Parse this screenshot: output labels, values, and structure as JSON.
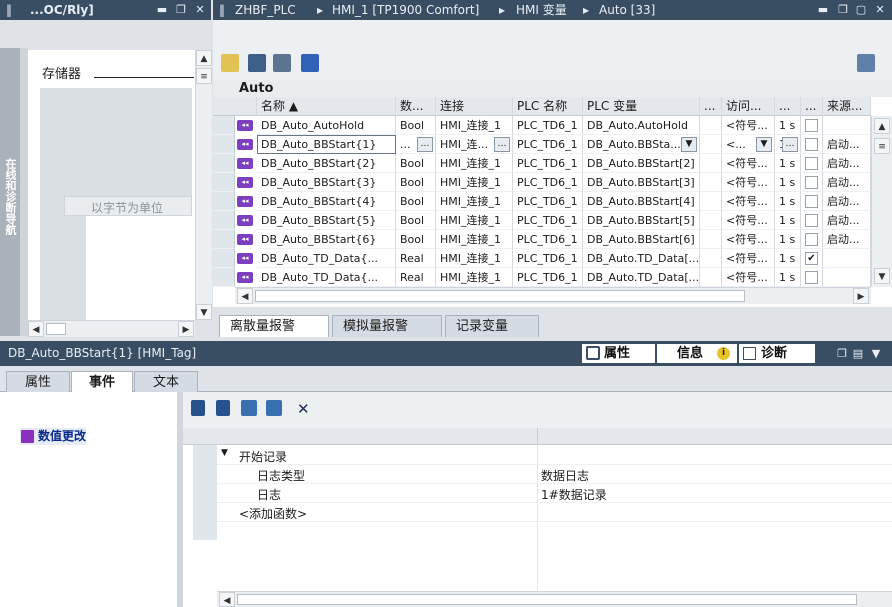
{
  "left_panel": {
    "title": "...OC/Rly]",
    "vertical_tab": "在线和诊断导航",
    "storage_label": "存储器",
    "unit_label": "以字节为单位"
  },
  "top_panel": {
    "breadcrumb": [
      "ZHBF_PLC",
      "HMI_1 [TP1900 Comfort]",
      "HMI 变量",
      "Auto [33]"
    ],
    "table_title": "Auto",
    "columns": [
      "名称 ▲",
      "数...",
      "连接",
      "PLC 名称",
      "PLC 变量",
      "...",
      "访问...",
      "...",
      "...",
      "来源..."
    ],
    "rows": [
      {
        "name": "DB_Auto_AutoHold",
        "type": "Bool",
        "conn": "HMI_连接_1",
        "plc": "PLC_TD6_1",
        "var": "DB_Auto.AutoHold",
        "access": "<符号...",
        "cycle": "1 s",
        "checked": false,
        "src": ""
      },
      {
        "name": "DB_Auto_BBStart{1}",
        "type": "...",
        "conn": "HMI_连...",
        "plc": "PLC_TD6_1",
        "var": "DB_Auto.BBSta...",
        "access": "<...",
        "cycle": "1 s",
        "checked": false,
        "src": "启动..."
      },
      {
        "name": "DB_Auto_BBStart{2}",
        "type": "Bool",
        "conn": "HMI_连接_1",
        "plc": "PLC_TD6_1",
        "var": "DB_Auto.BBStart[2]",
        "access": "<符号...",
        "cycle": "1 s",
        "checked": false,
        "src": "启动..."
      },
      {
        "name": "DB_Auto_BBStart{3}",
        "type": "Bool",
        "conn": "HMI_连接_1",
        "plc": "PLC_TD6_1",
        "var": "DB_Auto.BBStart[3]",
        "access": "<符号...",
        "cycle": "1 s",
        "checked": false,
        "src": "启动..."
      },
      {
        "name": "DB_Auto_BBStart{4}",
        "type": "Bool",
        "conn": "HMI_连接_1",
        "plc": "PLC_TD6_1",
        "var": "DB_Auto.BBStart[4]",
        "access": "<符号...",
        "cycle": "1 s",
        "checked": false,
        "src": "启动..."
      },
      {
        "name": "DB_Auto_BBStart{5}",
        "type": "Bool",
        "conn": "HMI_连接_1",
        "plc": "PLC_TD6_1",
        "var": "DB_Auto.BBStart[5]",
        "access": "<符号...",
        "cycle": "1 s",
        "checked": false,
        "src": "启动..."
      },
      {
        "name": "DB_Auto_BBStart{6}",
        "type": "Bool",
        "conn": "HMI_连接_1",
        "plc": "PLC_TD6_1",
        "var": "DB_Auto.BBStart[6]",
        "access": "<符号...",
        "cycle": "1 s",
        "checked": false,
        "src": "启动..."
      },
      {
        "name": "DB_Auto_TD_Data{...",
        "type": "Real",
        "conn": "HMI_连接_1",
        "plc": "PLC_TD6_1",
        "var": "DB_Auto.TD_Data[...",
        "access": "<符号...",
        "cycle": "1 s",
        "checked": true,
        "src": ""
      },
      {
        "name": "DB_Auto_TD_Data{...",
        "type": "Real",
        "conn": "HMI_连接_1",
        "plc": "PLC_TD6_1",
        "var": "DB_Auto.TD_Data[...",
        "access": "<符号...",
        "cycle": "1 s",
        "checked": false,
        "src": ""
      }
    ],
    "bottom_tabs": [
      "离散量报警",
      "模拟量报警",
      "记录变量"
    ]
  },
  "bottom_panel": {
    "title": "DB_Auto_BBStart{1} [HMI_Tag]",
    "right_tabs": [
      "属性",
      "信息",
      "诊断"
    ],
    "tabs": [
      "属性",
      "事件",
      "文本"
    ],
    "event_item": "数值更改",
    "tree": {
      "group": "开始记录",
      "rows": [
        {
          "label": "日志类型",
          "value": "数据日志"
        },
        {
          "label": "日志",
          "value": "1#数据记录"
        }
      ],
      "add": "<添加函数>"
    }
  }
}
